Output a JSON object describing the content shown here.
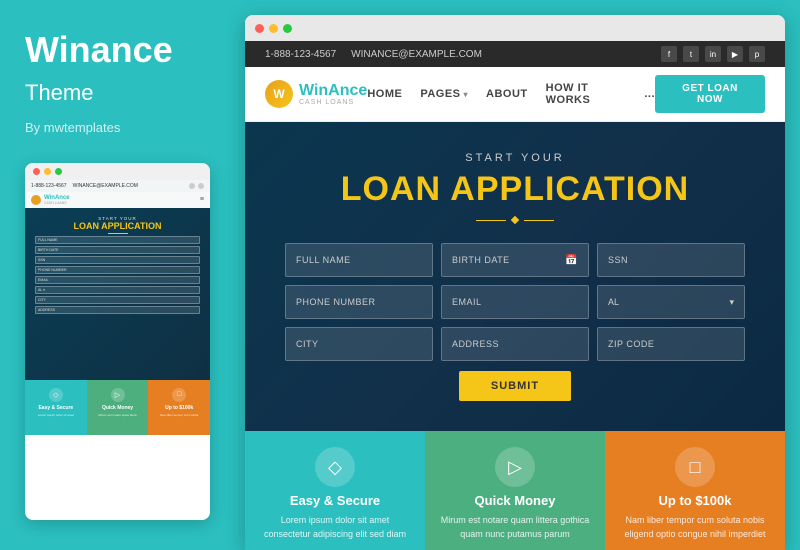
{
  "left": {
    "title": "Winance",
    "subtitle": "Theme",
    "author": "By mwtemplates"
  },
  "minisite": {
    "topbar": {
      "phone": "1-888-123-4567",
      "email": "WINANCE@EXAMPLE.COM"
    },
    "logo": {
      "name": "WinAnce",
      "tagline": "CASH LOANS"
    },
    "hero": {
      "sub": "START YOUR",
      "title": "LOAN APPLICATION"
    },
    "form": {
      "fields": [
        "FULL NAME",
        "BIRTH DATE",
        "SSN",
        "PHONE NUMBER",
        "EMAIL",
        "AL",
        "CITY",
        "ADDRESS"
      ]
    },
    "cards": [
      {
        "title": "Easy & Secure",
        "icon": "◇"
      },
      {
        "title": "Quick Money",
        "icon": "▷"
      },
      {
        "title": "Up to $100k",
        "icon": "□"
      }
    ]
  },
  "mainsite": {
    "topbar": {
      "phone": "1-888-123-4567",
      "email": "WINANCE@EXAMPLE.COM",
      "socials": [
        "f",
        "t",
        "in",
        "▶",
        "p"
      ]
    },
    "navbar": {
      "logo_name": "WinAnce",
      "logo_tagline": "CASH LOANS",
      "links": [
        "HOME",
        "PAGES",
        "ABOUT",
        "HOW IT WORKS",
        "..."
      ],
      "cta": "GET LOAN NOW"
    },
    "hero": {
      "sub": "START YOUR",
      "title": "LOAN APPLICATION"
    },
    "form": {
      "row1": [
        "FULL NAME",
        "BIRTH DATE",
        "SSN"
      ],
      "row2": [
        "PHONE NUMBER",
        "EMAIL",
        "AL"
      ],
      "row3": [
        "CITY",
        "ADDRESS",
        "ZIP CODE"
      ],
      "submit": "SUBMIT"
    },
    "feature_cards": [
      {
        "icon": "◇",
        "title": "Easy & Secure",
        "text": "Lorem ipsum dolor sit amet consectetur adipiscing elit sed diam"
      },
      {
        "icon": "▷",
        "title": "Quick Money",
        "text": "Mirum est notare quam littera gothica quam nunc putamus parum"
      },
      {
        "icon": "□",
        "title": "Up to $100k",
        "text": "Nam liber tempor cum soluta nobis eligend optio congue nihil imperdiet"
      }
    ]
  }
}
